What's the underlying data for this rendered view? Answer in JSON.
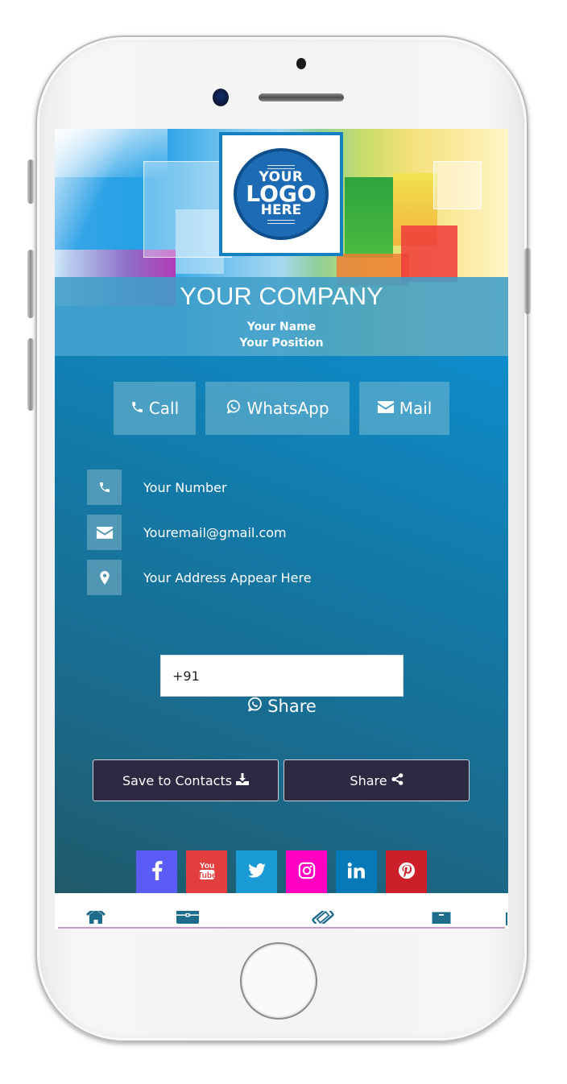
{
  "hero": {
    "logo": {
      "line1": "YOUR",
      "line2": "LOGO",
      "line3": "HERE"
    },
    "company": "YOUR COMPANY",
    "name": "Your Name",
    "position": "Your Position"
  },
  "actions": [
    {
      "label": "Call",
      "icon": "phone-icon"
    },
    {
      "label": "WhatsApp",
      "icon": "whatsapp-icon"
    },
    {
      "label": "Mail",
      "icon": "envelope-icon"
    }
  ],
  "contacts": [
    {
      "icon": "phone-icon",
      "text": "Your Number"
    },
    {
      "icon": "envelope-icon",
      "text": "Youremail@gmail.com"
    },
    {
      "icon": "map-marker-icon",
      "text": "Your Address Appear Here"
    }
  ],
  "whatsapp_share": {
    "input_value": "+91",
    "label": "Share"
  },
  "buttons": {
    "save_contacts": "Save to Contacts",
    "share": "Share"
  },
  "social": [
    {
      "name": "facebook",
      "glyph": "f",
      "color": "#5b5bf6"
    },
    {
      "name": "youtube",
      "glyph": "You Tube",
      "color": "#e33e3e"
    },
    {
      "name": "twitter",
      "glyph": "twitter",
      "color": "#1b9bd6"
    },
    {
      "name": "instagram",
      "glyph": "instagram",
      "color": "#ff00c3"
    },
    {
      "name": "linkedin",
      "glyph": "in",
      "color": "#0778b8"
    },
    {
      "name": "pinterest",
      "glyph": "P",
      "color": "#cc1f2a"
    }
  ],
  "bottom_nav": [
    {
      "icon": "home-icon"
    },
    {
      "icon": "briefcase-icon"
    },
    {
      "icon": "ticket-icon"
    },
    {
      "icon": "archive-icon"
    }
  ],
  "colors": {
    "accent": "#1a6a8c",
    "button_dark": "#2c2a43",
    "nav_icon": "#1e6c8b"
  }
}
